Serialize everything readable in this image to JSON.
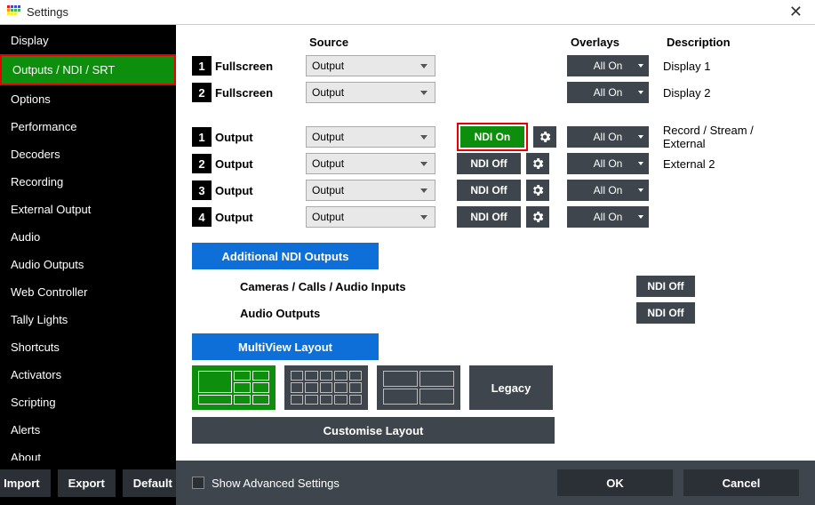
{
  "window": {
    "title": "Settings"
  },
  "sidebar": {
    "items": [
      {
        "label": "Display"
      },
      {
        "label": "Outputs / NDI / SRT"
      },
      {
        "label": "Options"
      },
      {
        "label": "Performance"
      },
      {
        "label": "Decoders"
      },
      {
        "label": "Recording"
      },
      {
        "label": "External Output"
      },
      {
        "label": "Audio"
      },
      {
        "label": "Audio Outputs"
      },
      {
        "label": "Web Controller"
      },
      {
        "label": "Tally Lights"
      },
      {
        "label": "Shortcuts"
      },
      {
        "label": "Activators"
      },
      {
        "label": "Scripting"
      },
      {
        "label": "Alerts"
      },
      {
        "label": "About"
      }
    ],
    "active_index": 1
  },
  "columns": {
    "source": "Source",
    "overlays": "Overlays",
    "description": "Description"
  },
  "fullscreen_rows": [
    {
      "n": "1",
      "label": "Fullscreen",
      "source": "Output",
      "overlay": "All On",
      "desc": "Display 1"
    },
    {
      "n": "2",
      "label": "Fullscreen",
      "source": "Output",
      "overlay": "All On",
      "desc": "Display 2"
    }
  ],
  "output_rows": [
    {
      "n": "1",
      "label": "Output",
      "source": "Output",
      "ndi": "NDI On",
      "ndi_on": true,
      "highlight": true,
      "overlay": "All On",
      "desc": "Record / Stream / External"
    },
    {
      "n": "2",
      "label": "Output",
      "source": "Output",
      "ndi": "NDI Off",
      "ndi_on": false,
      "overlay": "All On",
      "desc": "External 2"
    },
    {
      "n": "3",
      "label": "Output",
      "source": "Output",
      "ndi": "NDI Off",
      "ndi_on": false,
      "overlay": "All On",
      "desc": ""
    },
    {
      "n": "4",
      "label": "Output",
      "source": "Output",
      "ndi": "NDI Off",
      "ndi_on": false,
      "overlay": "All On",
      "desc": ""
    }
  ],
  "additional_ndi": {
    "button": "Additional NDI Outputs",
    "rows": [
      {
        "label": "Cameras / Calls / Audio Inputs",
        "ndi": "NDI Off"
      },
      {
        "label": "Audio Outputs",
        "ndi": "NDI Off"
      }
    ]
  },
  "multiview": {
    "header": "MultiView Layout",
    "legacy": "Legacy",
    "customise": "Customise Layout"
  },
  "footer": {
    "import": "Import",
    "export": "Export",
    "default": "Default",
    "advanced": "Show Advanced Settings",
    "ok": "OK",
    "cancel": "Cancel"
  },
  "logo_colors": [
    "#e51c23",
    "#3f51b5",
    "#3f51b5",
    "#3f51b5",
    "#ff9800",
    "#4caf50",
    "#4caf50",
    "#4caf50",
    "#ffeb3b",
    "#ffeb3b",
    "#ffeb3b"
  ]
}
